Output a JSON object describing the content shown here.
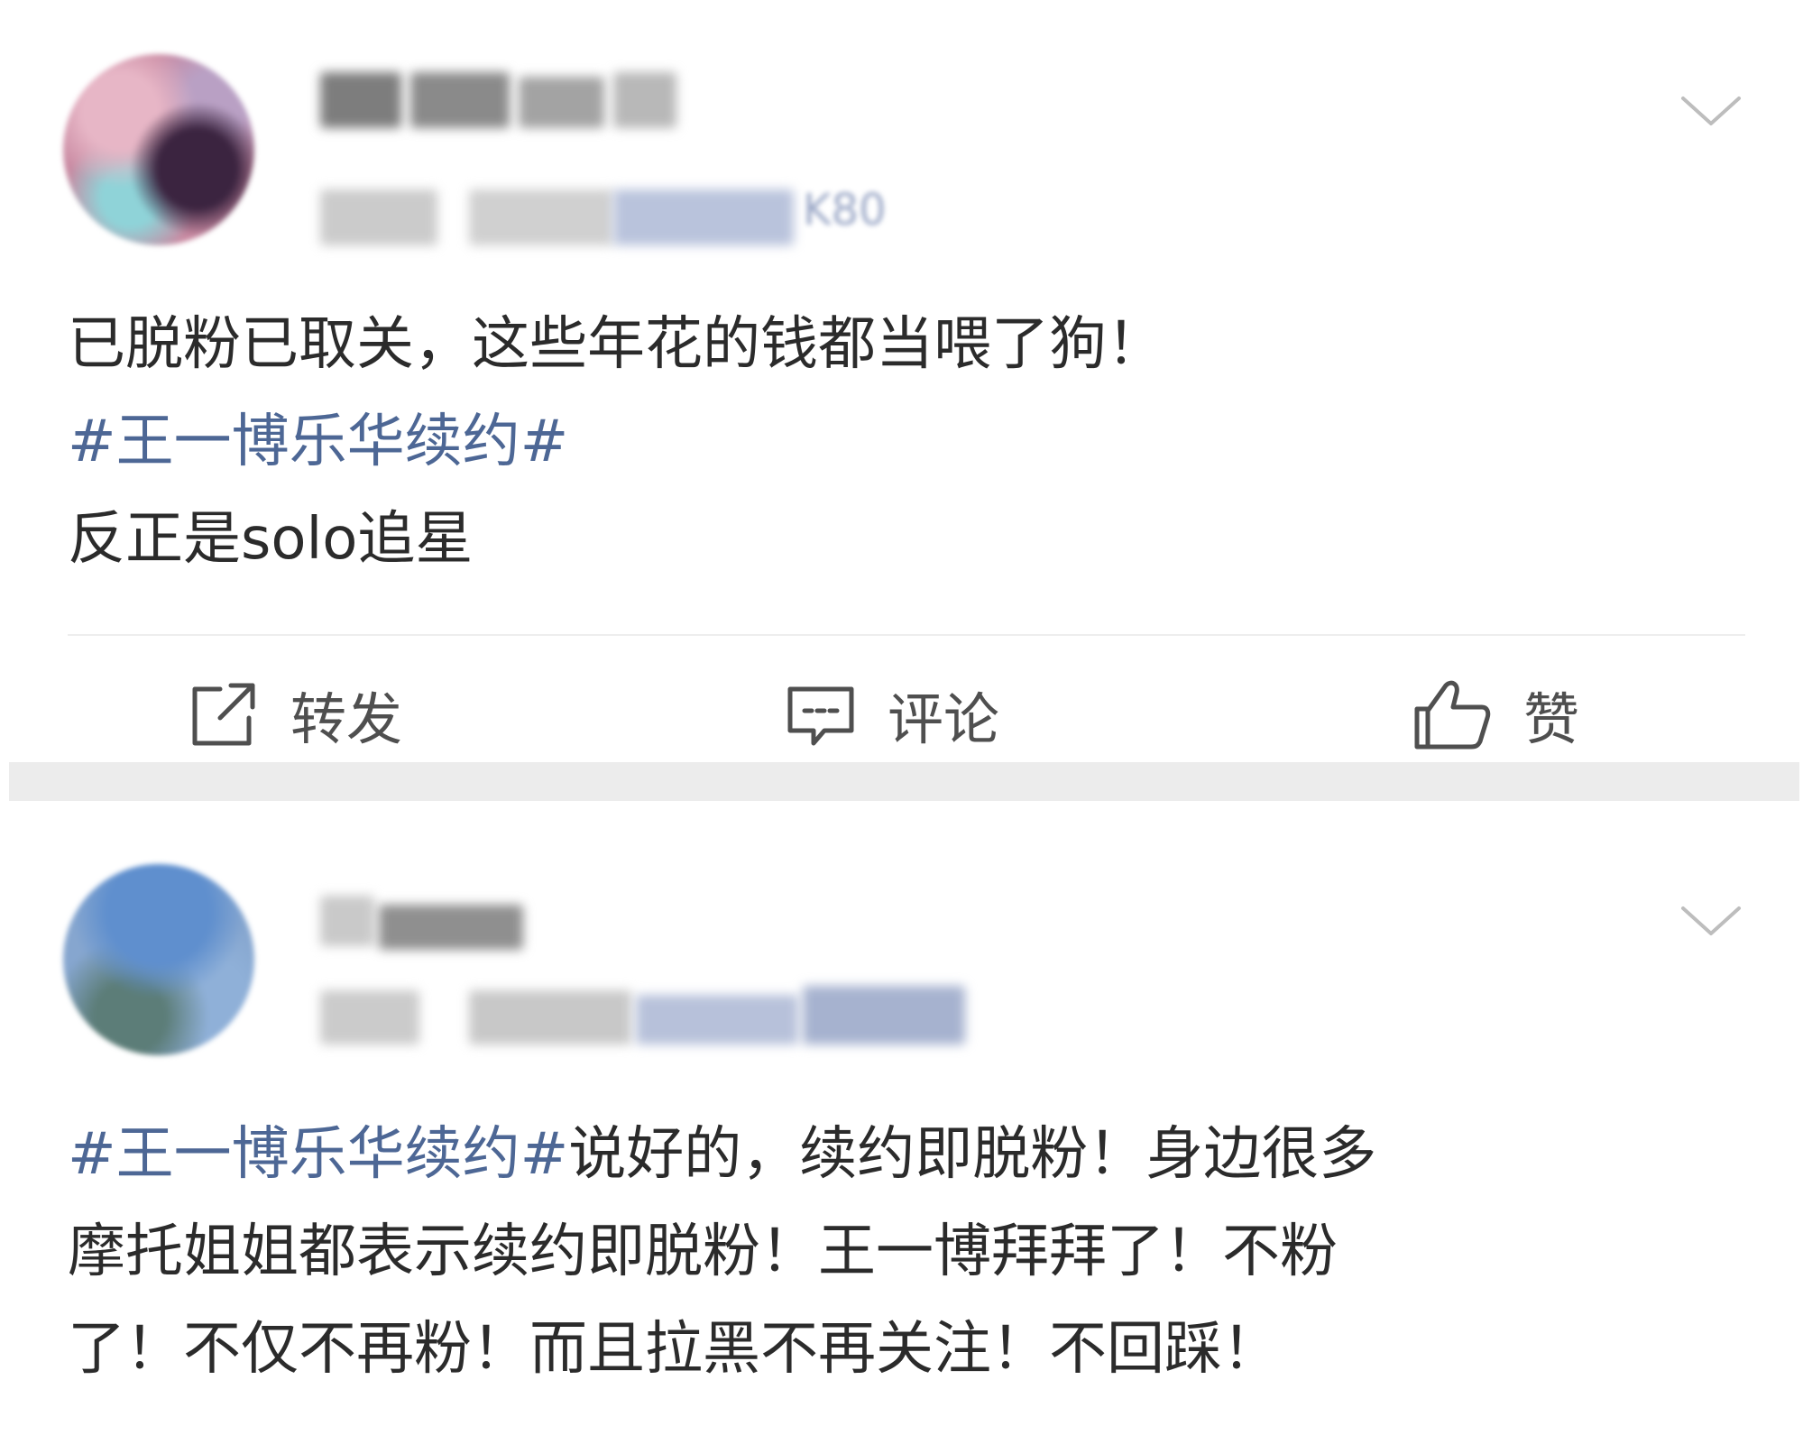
{
  "posts": [
    {
      "content_lines": [
        {
          "text": "已脱粉已取关，这些年花的钱都当喂了狗！"
        },
        {
          "topic": "#王一博乐华续约#"
        },
        {
          "text": "反正是solo追星"
        }
      ],
      "device_fragment": "K80",
      "actions": {
        "repost_label": "转发",
        "comment_label": "评论",
        "like_label": "赞"
      }
    },
    {
      "content_lines": [
        {
          "topic": "#王一博乐华续约#",
          "text": "说好的，续约即脱粉！身边很多"
        },
        {
          "text": "摩托姐姐都表示续约即脱粉！王一博拜拜了！不粉"
        },
        {
          "text": "了！不仅不再粉！而且拉黑不再关注！不回踩！"
        }
      ]
    }
  ],
  "icons": {
    "more": "chevron-down-icon",
    "repost": "share-out-icon",
    "comment": "comment-bubble-icon",
    "like": "thumbs-up-icon"
  },
  "colors": {
    "topic_link": "#4d6795",
    "body_text": "#2b2b2b",
    "action_text": "#4f4f4f",
    "separator": "#ececec"
  }
}
